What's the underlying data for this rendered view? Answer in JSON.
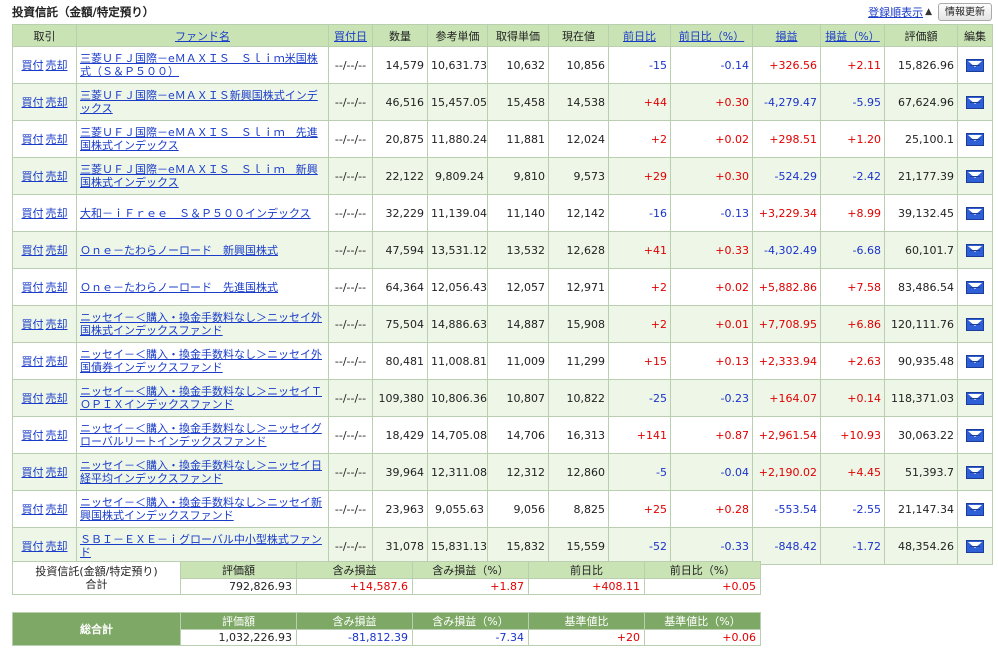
{
  "header": {
    "title": "投資信託（金額/特定預り）",
    "sort_link": "登録順表示",
    "sort_indicator": "▲",
    "refresh_label": "情報更新"
  },
  "columns": [
    "取引",
    "ファンド名",
    "買付日",
    "数量",
    "参考単価",
    "取得単価",
    "現在値",
    "前日比",
    "前日比（%）",
    "損益",
    "損益（%）",
    "評価額",
    "編集"
  ],
  "trade_labels": {
    "buy": "買付",
    "sell": "売却"
  },
  "rows": [
    {
      "fund": "三菱ＵＦＪ国際－eＭＡＸＩＳ　Ｓｌｉｍ米国株式（Ｓ＆Ｐ５００）",
      "date": "--/--/--",
      "qty": "14,579",
      "ref_price": "10,631.73",
      "acq_price": "10,632",
      "current": "10,856",
      "day_change": "-15",
      "day_change_pct": "-0.14",
      "pl": "+326.56",
      "pl_pct": "+2.11",
      "value": "15,826.96"
    },
    {
      "fund": "三菱ＵＦＪ国際－eＭＡＸＩＳ新興国株式インデックス",
      "date": "--/--/--",
      "qty": "46,516",
      "ref_price": "15,457.05",
      "acq_price": "15,458",
      "current": "14,538",
      "day_change": "+44",
      "day_change_pct": "+0.30",
      "pl": "-4,279.47",
      "pl_pct": "-5.95",
      "value": "67,624.96"
    },
    {
      "fund": "三菱ＵＦＪ国際－eＭＡＸＩＳ　Ｓｌｉｍ　先進国株式インデックス",
      "date": "--/--/--",
      "qty": "20,875",
      "ref_price": "11,880.24",
      "acq_price": "11,881",
      "current": "12,024",
      "day_change": "+2",
      "day_change_pct": "+0.02",
      "pl": "+298.51",
      "pl_pct": "+1.20",
      "value": "25,100.1"
    },
    {
      "fund": "三菱ＵＦＪ国際－eＭＡＸＩＳ　Ｓｌｉｍ　新興国株式インデックス",
      "date": "--/--/--",
      "qty": "22,122",
      "ref_price": "9,809.24",
      "acq_price": "9,810",
      "current": "9,573",
      "day_change": "+29",
      "day_change_pct": "+0.30",
      "pl": "-524.29",
      "pl_pct": "-2.42",
      "value": "21,177.39"
    },
    {
      "fund": "大和－ｉＦｒｅｅ　Ｓ＆Ｐ５００インデックス",
      "date": "--/--/--",
      "qty": "32,229",
      "ref_price": "11,139.04",
      "acq_price": "11,140",
      "current": "12,142",
      "day_change": "-16",
      "day_change_pct": "-0.13",
      "pl": "+3,229.34",
      "pl_pct": "+8.99",
      "value": "39,132.45"
    },
    {
      "fund": "Ｏｎｅ－たわらノーロード　新興国株式",
      "date": "--/--/--",
      "qty": "47,594",
      "ref_price": "13,531.12",
      "acq_price": "13,532",
      "current": "12,628",
      "day_change": "+41",
      "day_change_pct": "+0.33",
      "pl": "-4,302.49",
      "pl_pct": "-6.68",
      "value": "60,101.7"
    },
    {
      "fund": "Ｏｎｅ－たわらノーロード　先進国株式",
      "date": "--/--/--",
      "qty": "64,364",
      "ref_price": "12,056.43",
      "acq_price": "12,057",
      "current": "12,971",
      "day_change": "+2",
      "day_change_pct": "+0.02",
      "pl": "+5,882.86",
      "pl_pct": "+7.58",
      "value": "83,486.54"
    },
    {
      "fund": "ニッセイ－＜購入・換金手数料なし＞ニッセイ外国株式インデックスファンド",
      "date": "--/--/--",
      "qty": "75,504",
      "ref_price": "14,886.63",
      "acq_price": "14,887",
      "current": "15,908",
      "day_change": "+2",
      "day_change_pct": "+0.01",
      "pl": "+7,708.95",
      "pl_pct": "+6.86",
      "value": "120,111.76"
    },
    {
      "fund": "ニッセイ－＜購入・換金手数料なし＞ニッセイ外国債券インデックスファンド",
      "date": "--/--/--",
      "qty": "80,481",
      "ref_price": "11,008.81",
      "acq_price": "11,009",
      "current": "11,299",
      "day_change": "+15",
      "day_change_pct": "+0.13",
      "pl": "+2,333.94",
      "pl_pct": "+2.63",
      "value": "90,935.48"
    },
    {
      "fund": "ニッセイ－＜購入・換金手数料なし＞ニッセイＴＯＰＩＸインデックスファンド",
      "date": "--/--/--",
      "qty": "109,380",
      "ref_price": "10,806.36",
      "acq_price": "10,807",
      "current": "10,822",
      "day_change": "-25",
      "day_change_pct": "-0.23",
      "pl": "+164.07",
      "pl_pct": "+0.14",
      "value": "118,371.03"
    },
    {
      "fund": "ニッセイ－＜購入・換金手数料なし＞ニッセイグローバルリートインデックスファンド",
      "date": "--/--/--",
      "qty": "18,429",
      "ref_price": "14,705.08",
      "acq_price": "14,706",
      "current": "16,313",
      "day_change": "+141",
      "day_change_pct": "+0.87",
      "pl": "+2,961.54",
      "pl_pct": "+10.93",
      "value": "30,063.22"
    },
    {
      "fund": "ニッセイ－＜購入・換金手数料なし＞ニッセイ日経平均インデックスファンド",
      "date": "--/--/--",
      "qty": "39,964",
      "ref_price": "12,311.08",
      "acq_price": "12,312",
      "current": "12,860",
      "day_change": "-5",
      "day_change_pct": "-0.04",
      "pl": "+2,190.02",
      "pl_pct": "+4.45",
      "value": "51,393.7"
    },
    {
      "fund": "ニッセイ－＜購入・換金手数料なし＞ニッセイ新興国株式インデックスファンド",
      "date": "--/--/--",
      "qty": "23,963",
      "ref_price": "9,055.63",
      "acq_price": "9,056",
      "current": "8,825",
      "day_change": "+25",
      "day_change_pct": "+0.28",
      "pl": "-553.54",
      "pl_pct": "-2.55",
      "value": "21,147.34"
    },
    {
      "fund": "ＳＢＩ－ＥＸＥ－ｉグローバル中小型株式ファンド",
      "date": "--/--/--",
      "qty": "31,078",
      "ref_price": "15,831.13",
      "acq_price": "15,832",
      "current": "15,559",
      "day_change": "-52",
      "day_change_pct": "-0.33",
      "pl": "-848.42",
      "pl_pct": "-1.72",
      "value": "48,354.26"
    }
  ],
  "summary": {
    "label_line1": "投資信託(金額/特定預り)",
    "label_line2": "合計",
    "headers": [
      "評価額",
      "含み損益",
      "含み損益（%）",
      "前日比",
      "前日比（%）"
    ],
    "values": [
      "792,826.93",
      "+14,587.6",
      "+1.87",
      "+408.11",
      "+0.05"
    ]
  },
  "total": {
    "label": "総合計",
    "headers": [
      "評価額",
      "含み損益",
      "含み損益（%）",
      "基準値比",
      "基準値比（%）"
    ],
    "values": [
      "1,032,226.93",
      "-81,812.39",
      "-7.34",
      "+20",
      "+0.06"
    ]
  },
  "colors": {
    "positive": "#e10000",
    "negative": "#1a33cc",
    "header_bg": "#c9e3b5",
    "total_bg": "#7ea865"
  }
}
